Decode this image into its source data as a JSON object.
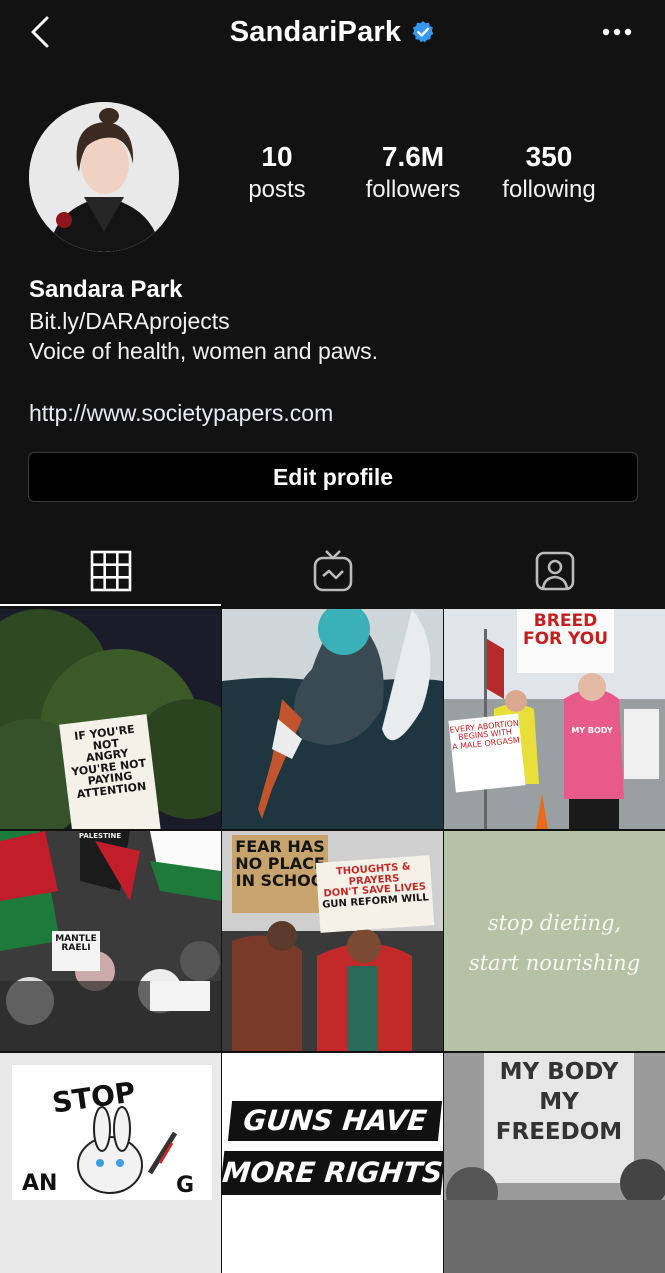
{
  "header": {
    "username": "SandariPark",
    "verified": true,
    "back_icon": "chevron-left-icon",
    "more_icon": "more-horizontal-icon"
  },
  "profile": {
    "stats": [
      {
        "value": "10",
        "label": "posts"
      },
      {
        "value": "7.6M",
        "label": "followers"
      },
      {
        "value": "350",
        "label": "following"
      }
    ],
    "name": "Sandara Park",
    "bio_line1": "Bit.ly/DARAprojects",
    "bio_line2": "Voice of health, women and paws.",
    "link": "http://www.societypapers.com",
    "edit_button": "Edit profile"
  },
  "tabs": [
    {
      "icon": "grid-icon",
      "active": true
    },
    {
      "icon": "igtv-icon",
      "active": false
    },
    {
      "icon": "tagged-icon",
      "active": false
    }
  ],
  "posts": {
    "p1": [
      "IF YOU'RE NOT",
      "ANGRY",
      "YOU'RE NOT PAYING",
      "ATTENTION"
    ],
    "p3": [
      "BREED",
      "FOR YOU"
    ],
    "p3b": [
      "EVERY ABORTION",
      "BEGINS WITH",
      "A MALE ORGASM"
    ],
    "p3c": "MY BODY",
    "p4": [
      "PALESTINE",
      "MANTLE",
      "RAELI"
    ],
    "p5a": [
      "FEAR HAS",
      "NO PLACE",
      "IN SCHOO"
    ],
    "p5b": [
      "THOUGHTS & PRAYERS",
      "DON'T SAVE LIVES",
      "GUN REFORM WILL"
    ],
    "p6": [
      "stop dieting,",
      "start nourishing"
    ],
    "p7": [
      "STOP",
      "AN",
      "G"
    ],
    "p8": [
      "GUNS HAVE",
      "MORE RIGHTS"
    ],
    "p9": [
      "MY BODY",
      "MY",
      "FREEDOM"
    ]
  },
  "colors": {
    "background": "#121212",
    "verified": "#3897f0",
    "post6_bg": "#b5c2a6"
  }
}
